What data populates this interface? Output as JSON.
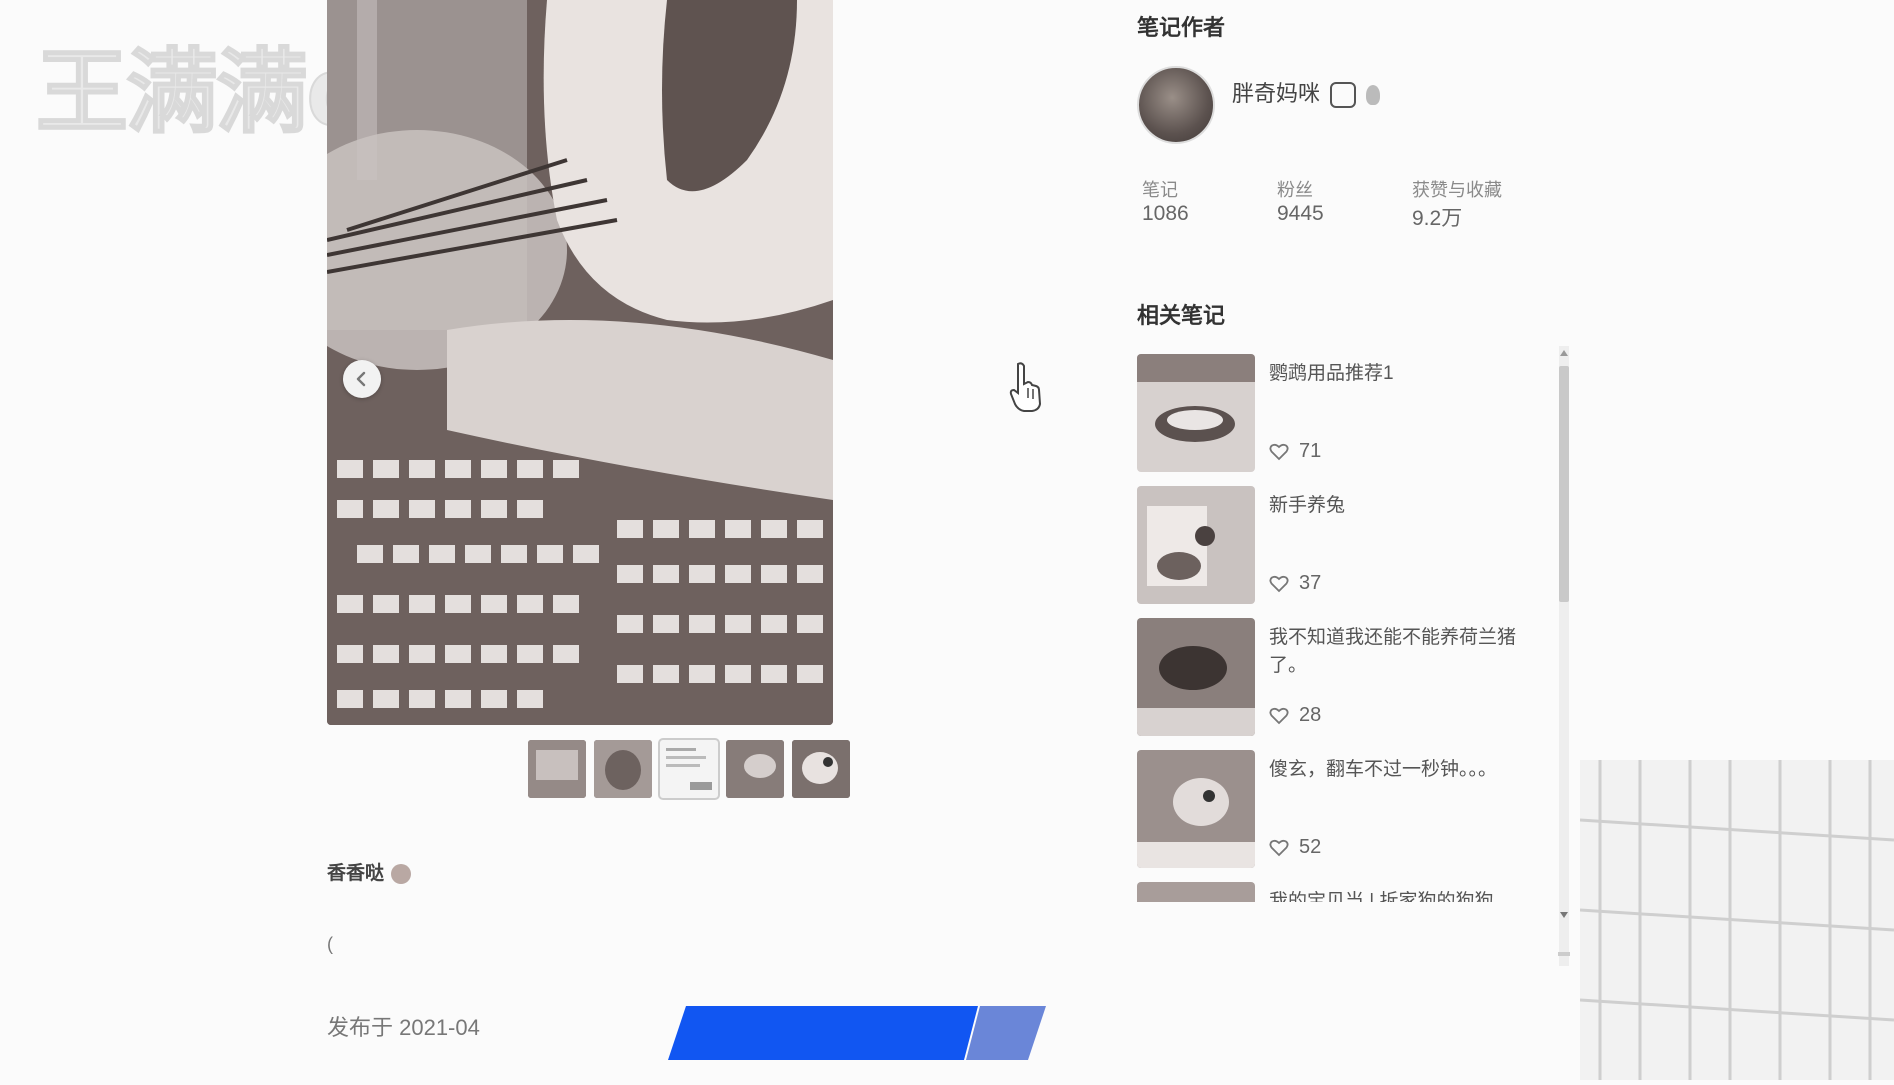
{
  "watermark": "王满满de 私 研",
  "post": {
    "caption": "香香哒",
    "small_glyph": "(",
    "publish_date": "发布于 2021-04"
  },
  "author": {
    "section_title": "笔记作者",
    "name": "胖奇妈咪",
    "stats": [
      {
        "label": "笔记",
        "value": "1086"
      },
      {
        "label": "粉丝",
        "value": "9445"
      },
      {
        "label": "获赞与收藏",
        "value": "9.2万"
      }
    ]
  },
  "related": {
    "section_title": "相关笔记",
    "items": [
      {
        "title": "鹦鹉用品推荐1",
        "likes": "71"
      },
      {
        "title": "新手养兔",
        "likes": "37"
      },
      {
        "title": "我不知道我还能不能养荷兰猪了。",
        "likes": "28"
      },
      {
        "title": "傻玄，翻车不过一秒钟。。。",
        "likes": "52"
      },
      {
        "title": "我的宝贝当 | 拆家狗的狗狗",
        "likes": ""
      }
    ]
  },
  "icons": {
    "prev": "chevron-left-icon",
    "next_cursor": "hand-pointer-icon",
    "like": "heart-icon"
  },
  "colors": {
    "accent_blue": "#1156f2",
    "accent_blue_light": "#6a86d8",
    "text_dark": "#333333",
    "text_muted": "#8a8a8a"
  }
}
